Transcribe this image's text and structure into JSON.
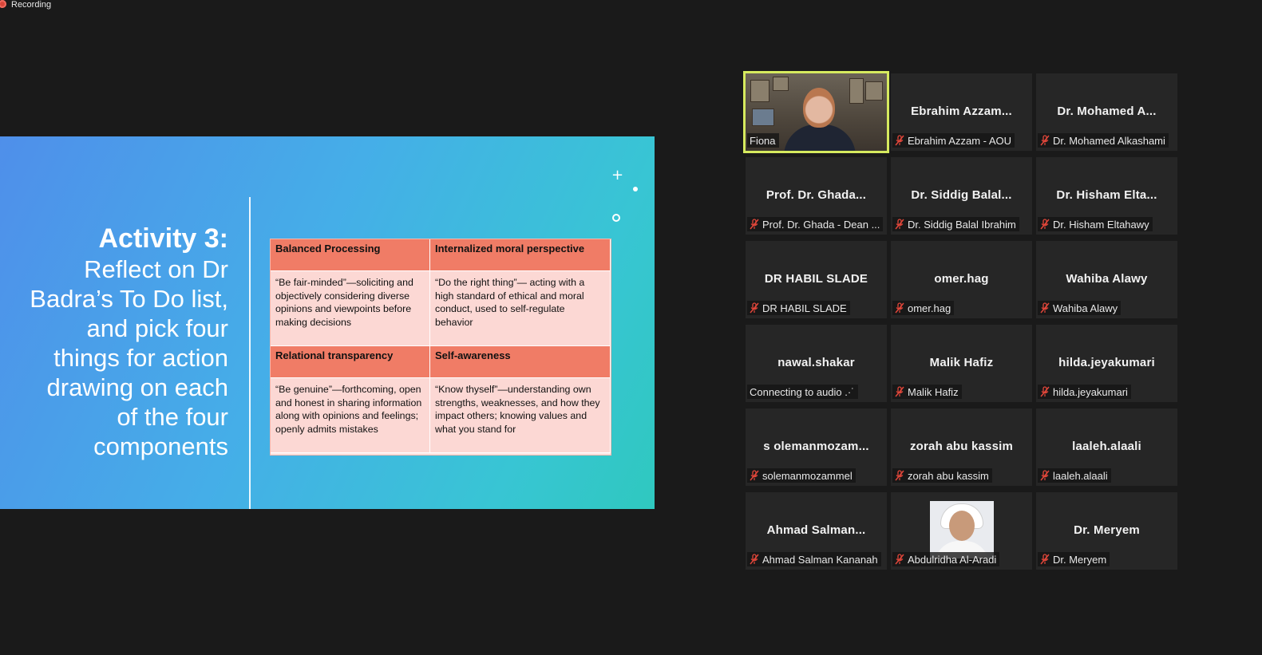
{
  "recording": {
    "label": "Recording"
  },
  "slide": {
    "title_bold": "Activity 3:",
    "title_lines": [
      "Reflect on Dr",
      "Badra’s To Do list,",
      "and pick four",
      "things for action",
      "drawing on each",
      "of the four",
      "components"
    ],
    "table": {
      "cells": [
        {
          "kind": "head",
          "text": "Balanced Processing"
        },
        {
          "kind": "head",
          "text": "Internalized moral perspective"
        },
        {
          "kind": "body",
          "text": "“Be fair-minded”—soliciting and objectively considering diverse opinions and viewpoints before making decisions"
        },
        {
          "kind": "body",
          "text": "“Do the right thing”— acting with a high standard of ethical and moral conduct, used to self-regulate behavior"
        },
        {
          "kind": "head",
          "text": "Relational transparency"
        },
        {
          "kind": "head",
          "text": "Self-awareness"
        },
        {
          "kind": "body",
          "text": "“Be genuine”—forthcoming, open and honest in sharing information along with opinions and feelings; openly admits mistakes"
        },
        {
          "kind": "body",
          "text": "“Know thyself”—understanding own strengths, weaknesses, and how they impact others; knowing values and what you stand for"
        }
      ]
    }
  },
  "participants": [
    {
      "display": "",
      "label": "Fiona",
      "muted": false,
      "video": true,
      "active": true
    },
    {
      "display": "Ebrahim  Azzam...",
      "label": "Ebrahim Azzam - AOU",
      "muted": true
    },
    {
      "display": "Dr. Mohamed  A...",
      "label": "Dr. Mohamed Alkashami",
      "muted": true
    },
    {
      "display": "Prof. Dr. Ghada...",
      "label": "Prof. Dr. Ghada - Dean ...",
      "muted": true
    },
    {
      "display": "Dr. Siddig  Balal...",
      "label": "Dr. Siddig Balal Ibrahim",
      "muted": true
    },
    {
      "display": "Dr. Hisham  Elta...",
      "label": "Dr. Hisham Eltahawy",
      "muted": true
    },
    {
      "display": "DR HABIL SLADE",
      "label": "DR HABIL SLADE",
      "muted": true
    },
    {
      "display": "omer.hag",
      "label": "omer.hag",
      "muted": true
    },
    {
      "display": "Wahiba Alawy",
      "label": "Wahiba Alawy",
      "muted": true
    },
    {
      "display": "nawal.shakar",
      "label": "Connecting to audio .·˙",
      "muted": false
    },
    {
      "display": "Malik Hafiz",
      "label": "Malik Hafiz",
      "muted": true
    },
    {
      "display": "hilda.jeyakumari",
      "label": "hilda.jeyakumari",
      "muted": true
    },
    {
      "display": "s olemanmozam...",
      "label": "solemanmozammel",
      "muted": true
    },
    {
      "display": "zorah abu kassim",
      "label": "zorah abu kassim",
      "muted": true
    },
    {
      "display": "laaleh.alaali",
      "label": "laaleh.alaali",
      "muted": true
    },
    {
      "display": "Ahmad  Salman...",
      "label": "Ahmad Salman Kananah",
      "muted": true
    },
    {
      "display": "",
      "label": "Abdulridha Al-Aradi",
      "muted": true,
      "avatar": true
    },
    {
      "display": "Dr. Meryem",
      "label": "Dr. Meryem",
      "muted": true
    }
  ],
  "colors": {
    "active_speaker": "#d6ea5e",
    "mute_icon": "#e0463a",
    "table_head": "#f07c66",
    "table_body": "#fcd8d4"
  }
}
